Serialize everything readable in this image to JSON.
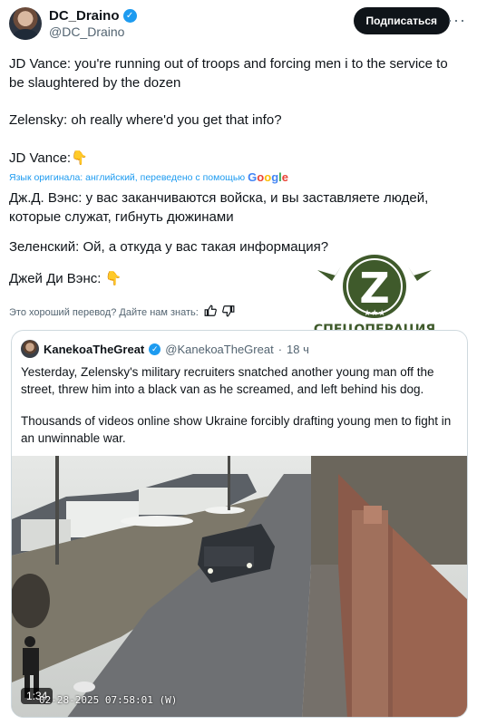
{
  "author": {
    "display_name": "DC_Draino",
    "handle": "@DC_Draino",
    "verified_icon": "✓"
  },
  "header": {
    "subscribe_label": "Подписаться",
    "more_label": "···"
  },
  "tweet": {
    "line1": "JD Vance: you're running out of troops and forcing men i to the service to be slaughtered by the dozen",
    "line2": "Zelensky: oh really where'd you get that info?",
    "line3": "JD Vance:👇",
    "translation_note": "Язык оригинала: английский, переведено с помощью",
    "translation_provider": "Google",
    "ru1": "Дж.Д. Вэнс: у вас заканчиваются войска, и вы заставляете людей, которые служат, гибнуть дюжинами",
    "ru2": "Зеленский: Ой, а откуда у вас такая информация?",
    "ru3": "Джей Ди Вэнс: 👇",
    "feedback_prompt": "Это хороший перевод? Дайте нам знать:"
  },
  "logo": {
    "letter": "Z",
    "text": "СПЕЦОПЕРАЦИЯ",
    "color": "#3f5a2b"
  },
  "quote": {
    "name": "KanekoaTheGreat",
    "handle": "@KanekoaTheGreat",
    "dot": "·",
    "time": "18 ч",
    "text1": "Yesterday, Zelensky's military recruiters snatched another young man off the street, threw him into a black van as he screamed, and left behind his dog.",
    "text2": "Thousands of videos online show Ukraine forcibly drafting young men to fight in an unwinnable war.",
    "video": {
      "duration": "1:34",
      "timestamp": "02-28-2025 07:58:01  (W)"
    }
  },
  "colors": {
    "accent": "#1d9bf0",
    "text": "#0f1419",
    "muted": "#536471",
    "border": "#cfd9de"
  }
}
